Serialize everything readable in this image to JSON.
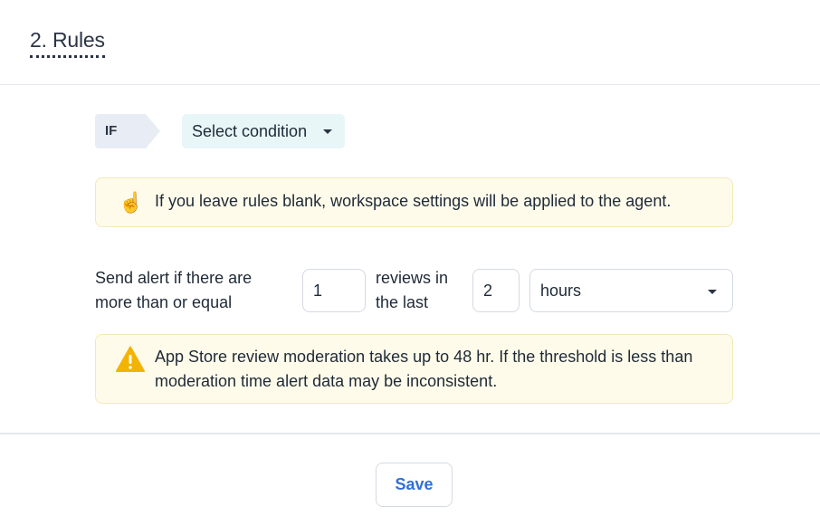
{
  "section": {
    "title": "2. Rules"
  },
  "rule": {
    "if_label": "IF",
    "condition_select": {
      "selected": "Select condition"
    }
  },
  "info_notice": {
    "icon": "pointing-up-hand-icon",
    "text": "If you leave rules blank, workspace settings will be applied to the agent."
  },
  "alert_rule": {
    "prefix_line1": "Send alert if there are",
    "prefix_line2": "more than or equal",
    "count_value": "1",
    "middle_line1": "reviews in",
    "middle_line2": "the last",
    "window_value": "2",
    "unit_selected": "hours"
  },
  "warning_notice": {
    "icon": "warning-triangle-icon",
    "text": "App Store review moderation takes up to 48 hr. If the threshold is less than moderation time alert data may be inconsistent."
  },
  "footer": {
    "save_label": "Save"
  },
  "colors": {
    "accent_blue": "#2f6fd6",
    "notice_bg": "#fefbea",
    "condition_bg": "#e8f6f8",
    "warning_yellow": "#f2b400"
  }
}
